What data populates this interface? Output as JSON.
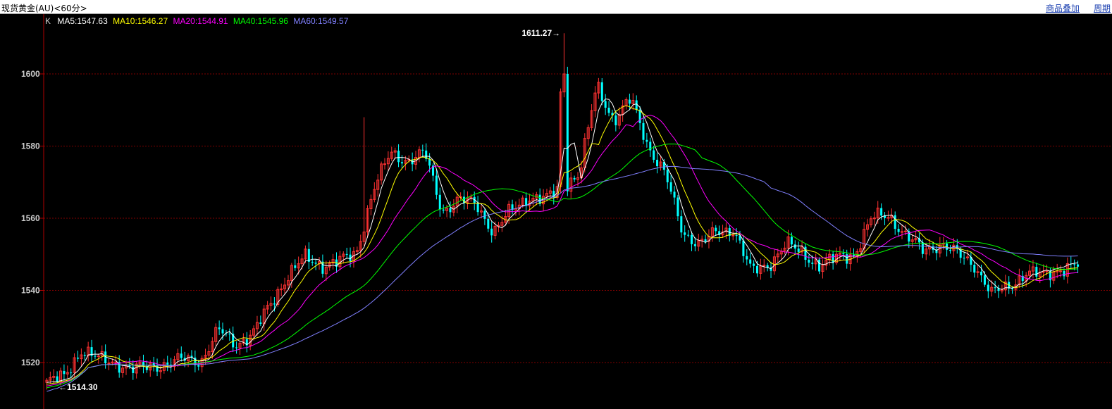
{
  "window": {
    "title": "现货黄金(AU)<60分>",
    "overlay_link": "商品叠加",
    "period_link": "周期"
  },
  "ma_legend": {
    "k_label": "K",
    "items": [
      {
        "text": "MA5:1547.63",
        "color": "#ffffff"
      },
      {
        "text": "MA10:1546.27",
        "color": "#ffff00"
      },
      {
        "text": "MA20:1544.91",
        "color": "#ff00ff"
      },
      {
        "text": "MA40:1545.96",
        "color": "#00ff00"
      },
      {
        "text": "MA60:1549.57",
        "color": "#8080ff"
      }
    ]
  },
  "colors": {
    "up": "#ff3232",
    "down": "#00ffff",
    "grid": "#800000",
    "axis": "#b00000",
    "ma5": "#ffffff",
    "ma10": "#ffff00",
    "ma20": "#ff00ff",
    "ma40": "#00ff00",
    "ma60": "#8080ff"
  },
  "chart_data": {
    "type": "candlestick",
    "instrument": "现货黄金(AU)",
    "period": "60分",
    "ylim": [
      1510,
      1618
    ],
    "y_ticks": [
      "1520",
      "1540",
      "1560",
      "1580",
      "1600"
    ],
    "y_tick_values": [
      1520,
      1540,
      1560,
      1580,
      1600
    ],
    "grid": true,
    "max_annotation": {
      "label": "1611.27→",
      "value": 1611.27
    },
    "min_annotation": {
      "label": "←1514.30",
      "value": 1514.3
    },
    "price_anchors": [
      [
        1514.5,
        1516,
        1523.5,
        1521,
        1520,
        1518,
        1519,
        1519.5,
        1521,
        1520.5,
        1529,
        1525,
        1528,
        1536,
        1544,
        1549,
        1547,
        1548,
        1550,
        1568,
        1578,
        1576,
        1578,
        1562,
        1565,
        1564,
        1556,
        1562,
        1566,
        1565,
        1569,
        1572,
        1597,
        1587,
        1593,
        1580,
        1572,
        1556,
        1553,
        1556,
        1557,
        1545,
        1547,
        1553,
        1550,
        1547,
        1549,
        1550,
        1560,
        1561,
        1555,
        1551,
        1553,
        1550,
        1547,
        1539,
        1541,
        1545,
        1544,
        1546,
        1547
      ]
    ],
    "ma_final": {
      "MA5": 1547.63,
      "MA10": 1546.27,
      "MA20": 1544.91,
      "MA40": 1545.96,
      "MA60": 1549.57
    },
    "ma_start": {
      "MA5": 1514.5,
      "MA10": 1514.0,
      "MA20": 1513.5,
      "MA40": 1513.0,
      "MA60": 1512.0
    }
  }
}
